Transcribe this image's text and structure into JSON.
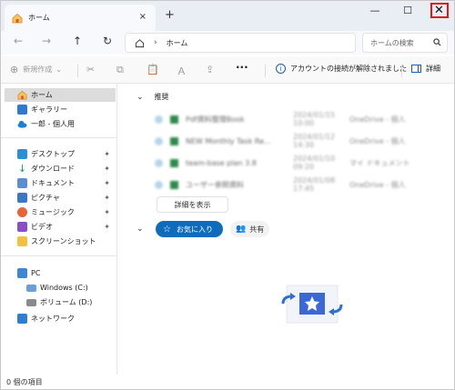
{
  "window": {
    "tab_label": "ホーム",
    "tab_close": "×",
    "new_tab": "+",
    "minimize": "—",
    "maximize": "☐",
    "close": "✕"
  },
  "nav": {
    "back": "←",
    "forward": "→",
    "up": "↑",
    "refresh": "↻",
    "breadcrumb_chevron": "›",
    "breadcrumb_location": "ホーム",
    "search_placeholder": "ホームの検索"
  },
  "command_bar": {
    "new_label": "新規作成",
    "new_chevron": "⌄",
    "more": "···",
    "info_message": "アカウントの接続が解除されました",
    "details_label": "詳細"
  },
  "sidebar": {
    "items": [
      {
        "label": "ホーム",
        "icon": "home-icon"
      },
      {
        "label": "ギャラリー",
        "icon": "gallery-icon"
      },
      {
        "label": "一郎 - 個人用",
        "icon": "onedrive-icon"
      },
      {
        "label": "デスクトップ",
        "icon": "desktop-icon",
        "pinned": true
      },
      {
        "label": "ダウンロード",
        "icon": "download-icon",
        "pinned": true
      },
      {
        "label": "ドキュメント",
        "icon": "documents-icon",
        "pinned": true
      },
      {
        "label": "ピクチャ",
        "icon": "pictures-icon",
        "pinned": true
      },
      {
        "label": "ミュージック",
        "icon": "music-icon",
        "pinned": true
      },
      {
        "label": "ビデオ",
        "icon": "video-icon",
        "pinned": true
      },
      {
        "label": "スクリーンショット",
        "icon": "folder-icon"
      },
      {
        "label": "PC",
        "icon": "pc-icon"
      },
      {
        "label": "Windows (C:)",
        "icon": "drive-icon"
      },
      {
        "label": "ボリューム (D:)",
        "icon": "drive-icon"
      },
      {
        "label": "ネットワーク",
        "icon": "network-icon"
      }
    ],
    "pin_glyph": "📌"
  },
  "main": {
    "recommended_heading": "推奨",
    "collapse_caret": "⌄",
    "recent_rows": [
      {
        "name": "Pdf資料整理Book",
        "date": "2024/01/15 10:00",
        "location": "OneDrive - 個人"
      },
      {
        "name": "NEW Monthly Task Re...",
        "date": "2024/01/12 14:30",
        "location": "OneDrive - 個人"
      },
      {
        "name": "team-base plan 3.8",
        "date": "2024/01/10 09:20",
        "location": "マイ ドキュメント"
      },
      {
        "name": "ユーザー参照資料",
        "date": "2024/01/08 17:45",
        "location": "OneDrive - 個人"
      }
    ],
    "show_more": "詳細を表示",
    "favorites_tab": "お気に入り",
    "shared_tab": "共有"
  },
  "status": {
    "item_count": "0 個の項目"
  }
}
